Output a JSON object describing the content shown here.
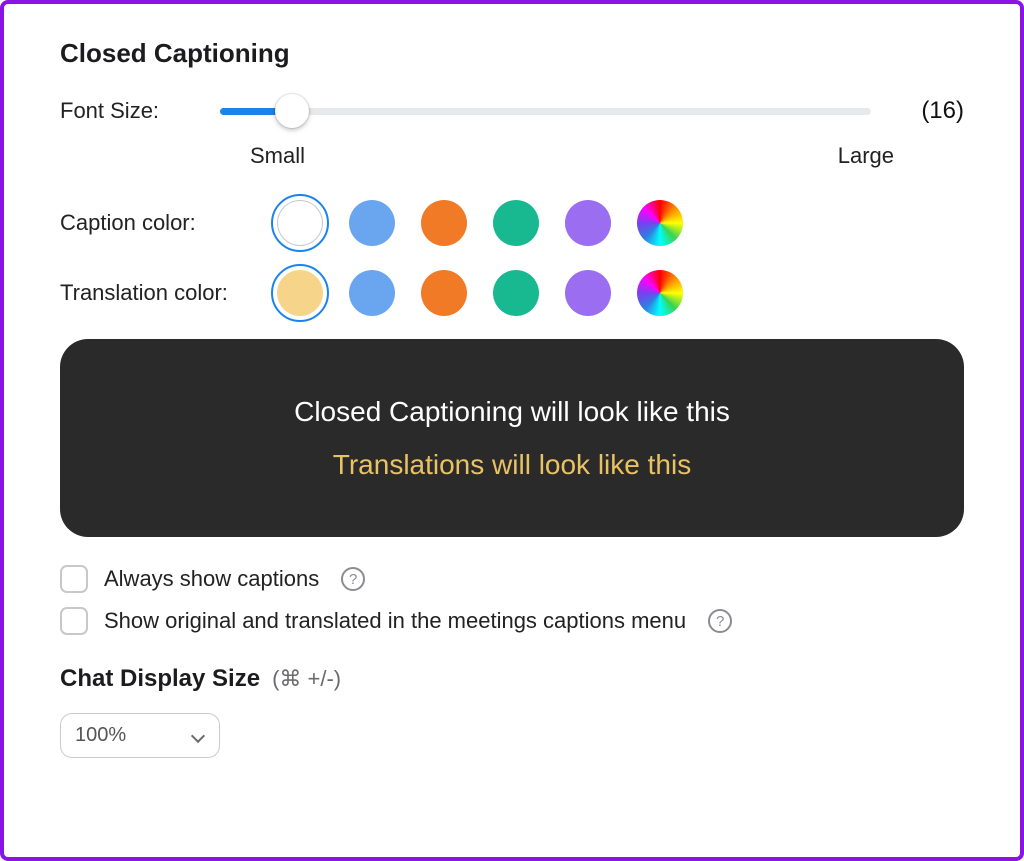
{
  "section_title": "Closed Captioning",
  "font_size": {
    "label": "Font Size:",
    "value_display": "(16)",
    "scale_small": "Small",
    "scale_large": "Large"
  },
  "caption_color": {
    "label": "Caption color:",
    "selected_index": 0,
    "swatches": [
      {
        "name": "white",
        "css": "#ffffff",
        "border": true
      },
      {
        "name": "blue",
        "css": "#6aa6f0"
      },
      {
        "name": "orange",
        "css": "#f07a26"
      },
      {
        "name": "teal",
        "css": "#18b890"
      },
      {
        "name": "purple",
        "css": "#9b6df0"
      },
      {
        "name": "rainbow",
        "css": "rainbow"
      }
    ]
  },
  "translation_color": {
    "label": "Translation color:",
    "selected_index": 0,
    "swatches": [
      {
        "name": "gold",
        "css": "#f6d58b"
      },
      {
        "name": "blue",
        "css": "#6aa6f0"
      },
      {
        "name": "orange",
        "css": "#f07a26"
      },
      {
        "name": "teal",
        "css": "#18b890"
      },
      {
        "name": "purple",
        "css": "#9b6df0"
      },
      {
        "name": "rainbow",
        "css": "rainbow"
      }
    ]
  },
  "preview": {
    "caption_text": "Closed Captioning will look like this",
    "translation_text": "Translations will look like this",
    "caption_color_css": "#ffffff",
    "translation_color_css": "#e9c262"
  },
  "options": {
    "always_show": "Always show captions",
    "show_original": "Show original and translated in the meetings captions menu"
  },
  "chat_display": {
    "title": "Chat Display Size",
    "shortcut": "(⌘ +/-)",
    "value": "100%"
  }
}
